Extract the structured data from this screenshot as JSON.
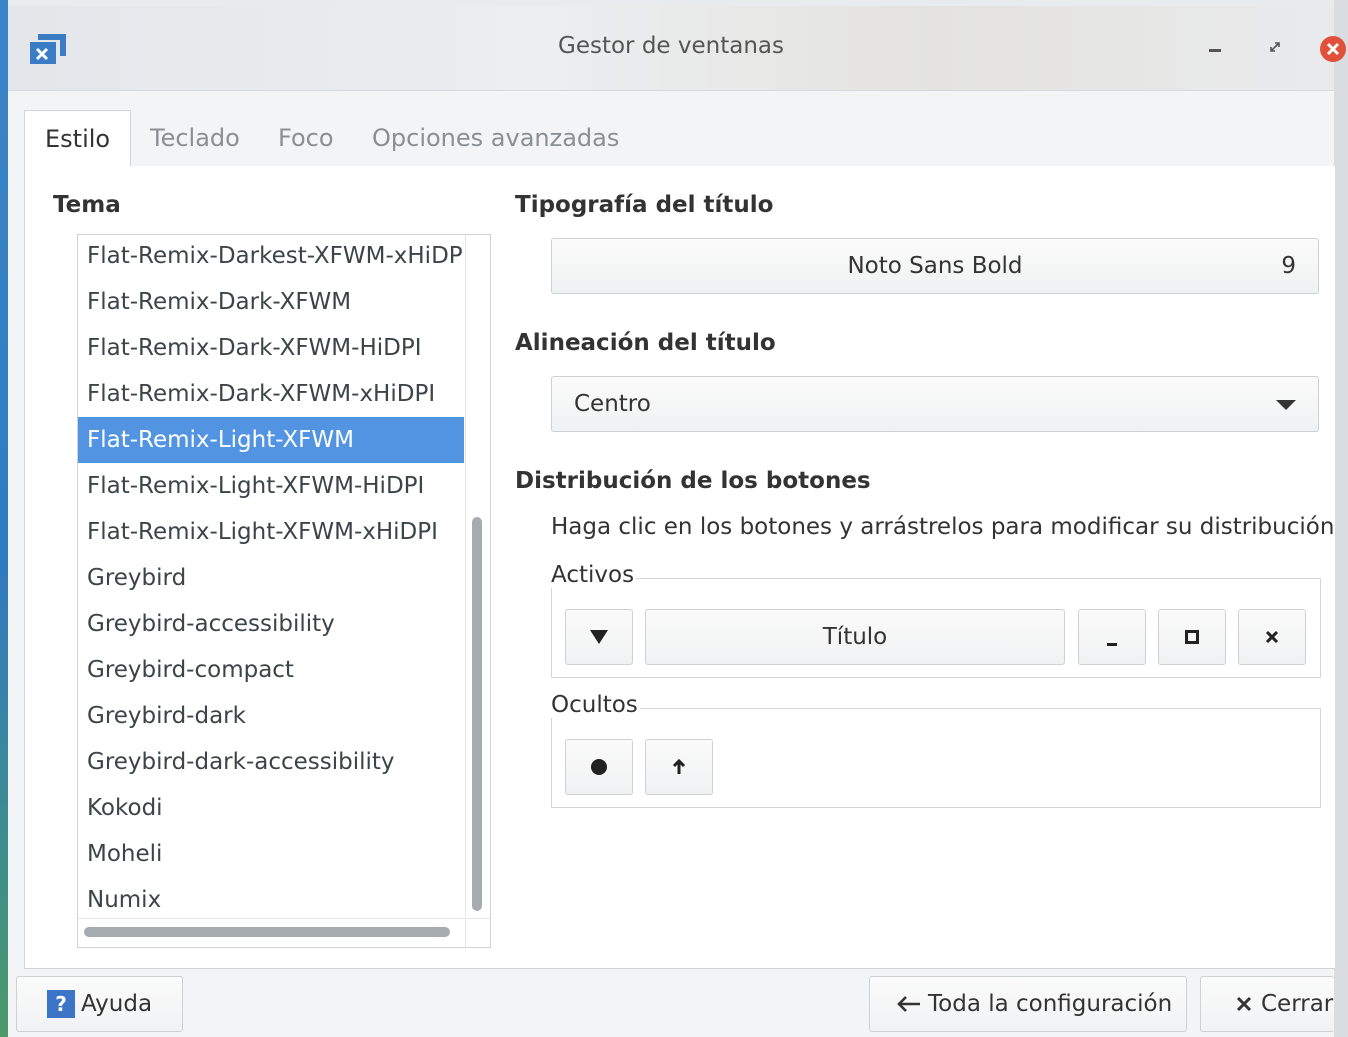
{
  "window": {
    "title": "Gestor de ventanas"
  },
  "tabs": [
    {
      "label": "Estilo",
      "active": true
    },
    {
      "label": "Teclado",
      "active": false
    },
    {
      "label": "Foco",
      "active": false
    },
    {
      "label": "Opciones avanzadas",
      "active": false
    }
  ],
  "theme": {
    "label": "Tema",
    "items": [
      "Flat-Remix-Darkest-XFWM-xHiDPI",
      "Flat-Remix-Dark-XFWM",
      "Flat-Remix-Dark-XFWM-HiDPI",
      "Flat-Remix-Dark-XFWM-xHiDPI",
      "Flat-Remix-Light-XFWM",
      "Flat-Remix-Light-XFWM-HiDPI",
      "Flat-Remix-Light-XFWM-xHiDPI",
      "Greybird",
      "Greybird-accessibility",
      "Greybird-compact",
      "Greybird-dark",
      "Greybird-dark-accessibility",
      "Kokodi",
      "Moheli",
      "Numix"
    ],
    "selected": "Flat-Remix-Light-XFWM"
  },
  "title_font": {
    "label": "Tipografía del título",
    "name": "Noto Sans Bold",
    "size": "9"
  },
  "title_alignment": {
    "label": "Alineación del título",
    "value": "Centro"
  },
  "buttons_layout": {
    "label": "Distribución de los botones",
    "hint": "Haga clic en los botones y arrástrelos para modificar su distribución",
    "active_label": "Activos",
    "hidden_label": "Ocultos",
    "title_button": "Título"
  },
  "bottom": {
    "help": "Ayuda",
    "all_settings": "Toda la configuración",
    "close": "Cerrar"
  },
  "colors": {
    "selection": "#5294e2",
    "close_button": "#e0503a",
    "help_icon": "#3c74c8"
  }
}
